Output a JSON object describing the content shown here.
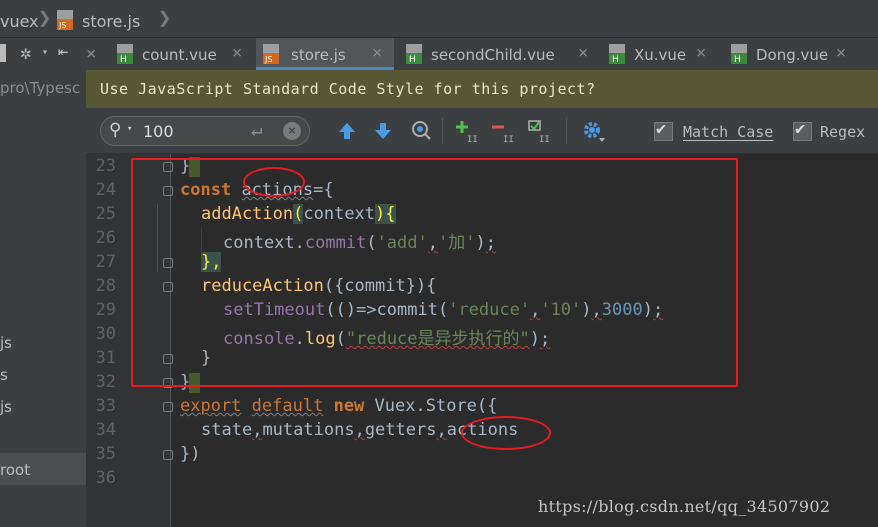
{
  "breadcrumb": {
    "items": [
      "vuex",
      "store.js"
    ]
  },
  "project_panel": {
    "path_text": "pro\\Typesc",
    "items": [
      "js",
      "s",
      "js",
      "root"
    ]
  },
  "tabs": [
    {
      "label": "count.vue",
      "icon": "vue-file-icon",
      "active": false
    },
    {
      "label": "store.js",
      "icon": "js-file-icon",
      "active": true
    },
    {
      "label": "secondChild.vue",
      "icon": "vue-file-icon",
      "active": false
    },
    {
      "label": "Xu.vue",
      "icon": "vue-file-icon",
      "active": false
    },
    {
      "label": "Dong.vue",
      "icon": "vue-file-icon",
      "active": false
    }
  ],
  "tab_close_glyph": "×",
  "banner": {
    "text": "Use JavaScript Standard Code Style for this project?"
  },
  "search": {
    "value": "100",
    "match_case_label": "Match Case",
    "match_case_checked": true,
    "regex_label": "Regex",
    "regex_checked": true
  },
  "editor": {
    "line_numbers": [
      "23",
      "24",
      "25",
      "26",
      "27",
      "28",
      "29",
      "30",
      "31",
      "32",
      "33",
      "34",
      "35",
      "36"
    ]
  },
  "code": {
    "l24_kw": "const",
    "l24_name": "actions",
    "l24_rest": "={",
    "l25_fn": "addAction",
    "l25_paren_open": "(",
    "l25_param": "context",
    "l25_paren_close": ")",
    "l25_brace": "{",
    "l26_obj": "context.",
    "l26_method": "commit",
    "l26_open": "(",
    "l26_s1": "'add'",
    "l26_comma": ",",
    "l26_s2": "'加'",
    "l26_close": ")",
    "l26_semi": ";",
    "l27": "},",
    "l28_fn": "reduceAction",
    "l28_rest": "({commit}){",
    "l29_fn": "setTimeout",
    "l29_a": "(()=>commit(",
    "l29_s1": "'reduce'",
    "l29_comma": ",",
    "l29_s2": "'10'",
    "l29_b": ")",
    "l29_comma2": ",",
    "l29_num": "3000",
    "l29_c": ")",
    "l29_semi": ";",
    "l30_obj": "console",
    "l30_dot": ".",
    "l30_method": "log",
    "l30_open": "(",
    "l30_str": "\"reduce是异步执行的\"",
    "l30_close": ")",
    "l30_semi": ";",
    "l31": "}",
    "l32": "}",
    "l33_kw1": "export",
    "l33_kw2": "default",
    "l33_kw3": "new",
    "l33_rest": "Vuex.Store({",
    "l34_state": "state",
    "l34_mutations": "mutations",
    "l34_getters": "getters",
    "l34_actions": "actions",
    "l34_comma": ",",
    "l35": "})",
    "l23": "}"
  },
  "watermark": "https://blog.csdn.net/qq_34507902",
  "colors": {
    "annotation_red": "#e51c23",
    "banner_bg": "#585733",
    "keyword": "#cc7832",
    "function": "#ffc66d",
    "string": "#6a8759",
    "number": "#6897bb",
    "property": "#9876aa"
  }
}
